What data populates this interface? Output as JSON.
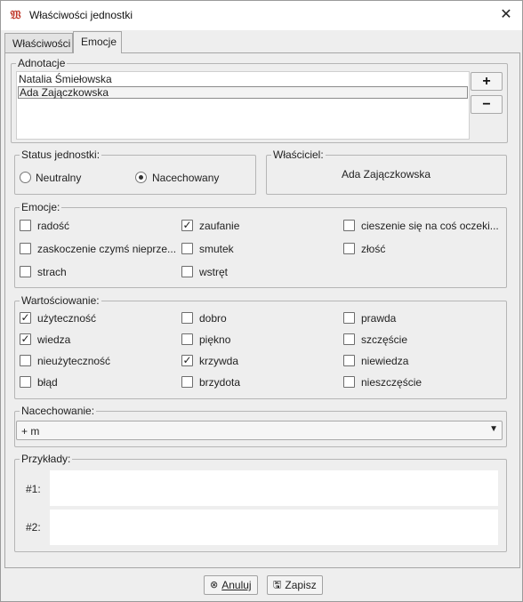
{
  "window": {
    "title": "Właściwości jednostki"
  },
  "tabs": [
    {
      "label": "Właściwości"
    },
    {
      "label": "Emocje"
    }
  ],
  "annotations": {
    "label": "Adnotacje",
    "items": [
      "Natalia Śmiełowska",
      "Ada Zajączkowska"
    ],
    "selected_index": 1,
    "add_label": "+",
    "remove_label": "−"
  },
  "status": {
    "label": "Status jednostki:",
    "options": [
      {
        "label": "Neutralny",
        "selected": false
      },
      {
        "label": "Nacechowany",
        "selected": true
      }
    ]
  },
  "owner": {
    "label": "Właściciel:",
    "value": "Ada Zajączkowska"
  },
  "emotions": {
    "label": "Emocje:",
    "items": [
      {
        "label": "radość",
        "checked": false
      },
      {
        "label": "zaufanie",
        "checked": true
      },
      {
        "label": "cieszenie się na coś oczeki...",
        "checked": false
      },
      {
        "label": "zaskoczenie czymś nieprze...",
        "checked": false
      },
      {
        "label": "smutek",
        "checked": false
      },
      {
        "label": "złość",
        "checked": false
      },
      {
        "label": "strach",
        "checked": false
      },
      {
        "label": "wstręt",
        "checked": false
      }
    ]
  },
  "valuation": {
    "label": "Wartościowanie:",
    "items": [
      {
        "label": "użyteczność",
        "checked": true
      },
      {
        "label": "dobro",
        "checked": false
      },
      {
        "label": "prawda",
        "checked": false
      },
      {
        "label": "wiedza",
        "checked": true
      },
      {
        "label": "piękno",
        "checked": false
      },
      {
        "label": "szczęście",
        "checked": false
      },
      {
        "label": "nieużyteczność",
        "checked": false
      },
      {
        "label": "krzywda",
        "checked": true
      },
      {
        "label": "niewiedza",
        "checked": false
      },
      {
        "label": "błąd",
        "checked": false
      },
      {
        "label": "brzydota",
        "checked": false
      },
      {
        "label": "nieszczęście",
        "checked": false
      }
    ]
  },
  "marking": {
    "label": "Nacechowanie:",
    "value": "+ m"
  },
  "examples": {
    "label": "Przykłady:",
    "items": [
      {
        "label": "#1:",
        "value": ""
      },
      {
        "label": "#2:",
        "value": ""
      }
    ]
  },
  "buttons": {
    "cancel": "Anuluj",
    "save": "Zapisz"
  },
  "icons": {
    "app": "app-logo-icon",
    "close": "close-icon",
    "cancel": "cancel-icon",
    "save": "floppy-disk-icon",
    "dropdown": "chevron-down-icon"
  }
}
